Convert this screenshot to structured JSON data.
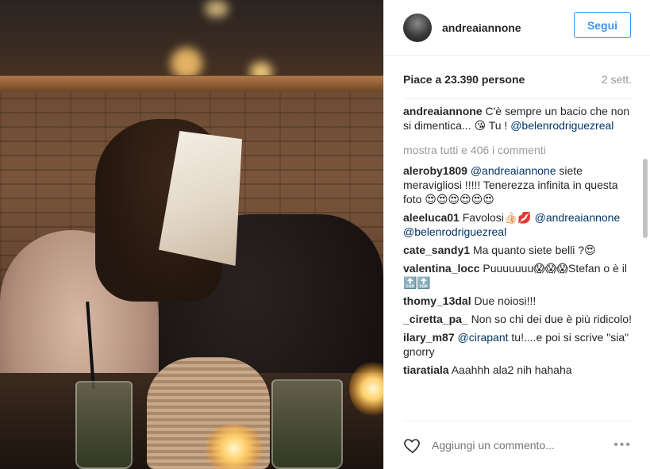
{
  "post": {
    "username": "andreaiannone",
    "follow_label": "Segui",
    "likes_text": "Piace a 23.390 persone",
    "time_ago": "2 sett."
  },
  "caption": {
    "user": "andreaiannone",
    "text": "C'è sempre un bacio che non si dimentica... 😘 Tu !",
    "mention": "@belenrodriguezreal"
  },
  "show_all_label": "mostra tutti e 406 i commenti",
  "comments": [
    {
      "user": "aleroby1809",
      "mention": "@andreaiannone",
      "text": "siete meravigliosi !!!!! Tenerezza infinita in questa foto 😍😍😍😍😍😍"
    },
    {
      "user": "aleeluca01",
      "text": "Favolosi👍🏻💋",
      "mentions": "@andreaiannone @belenrodriguezreal"
    },
    {
      "user": "cate_sandy1",
      "text": "Ma quanto siete belli ?😍"
    },
    {
      "user": "valentina_locc",
      "text": "Puuuuuuu😱😱😱Stefan o è il 🔝🔝"
    },
    {
      "user": "thomy_13dal",
      "text": "Due noiosi!!!"
    },
    {
      "user": "_ciretta_pa_",
      "text": "Non so chi dei due è più ridicolo!"
    },
    {
      "user": "ilary_m87",
      "mention": "@cirapant",
      "text": "tu!....e poi si scrive \"sia\" gnorry"
    },
    {
      "user": "tiaratiala",
      "text": "Aaahhh ala2 nih hahaha"
    }
  ],
  "footer": {
    "comment_placeholder": "Aggiungi un commento...",
    "more_icon": "•••"
  }
}
